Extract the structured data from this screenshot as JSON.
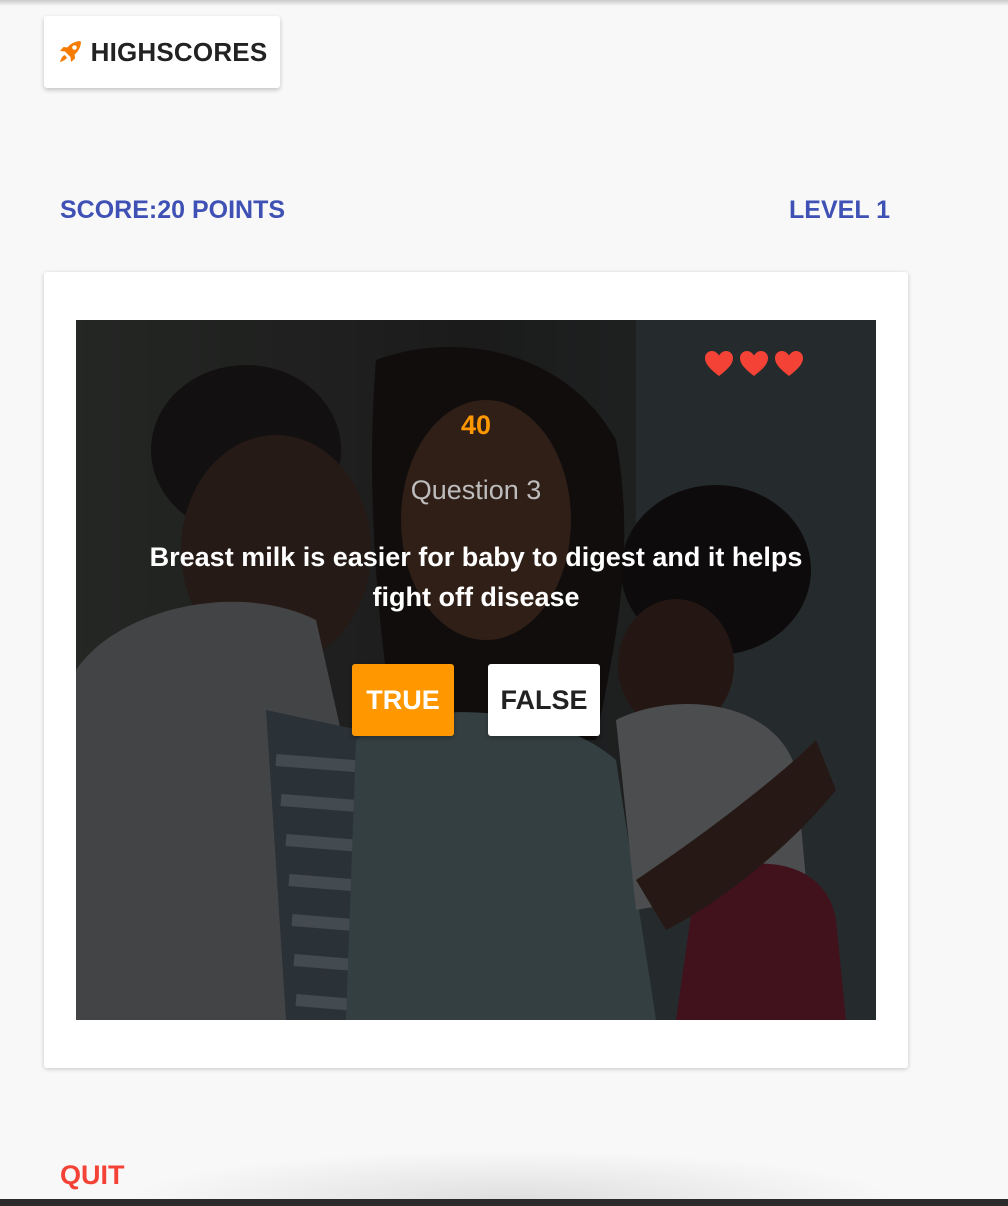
{
  "header": {
    "highscores_label": "HIGHSCORES",
    "highscores_icon": "rocket-icon",
    "icon_color": "#f57c00"
  },
  "status": {
    "score_text": "SCORE:20 POINTS",
    "level_text": "LEVEL 1",
    "accent_color": "#3f51b5"
  },
  "game": {
    "lives": 3,
    "life_icon": "heart-icon",
    "heart_color": "#f44336",
    "timer": "40",
    "question_number": "Question 3",
    "question_text": "Breast milk is easier for baby to digest and it helps fight off disease",
    "answers": {
      "true_label": "TRUE",
      "false_label": "FALSE"
    },
    "background_image": "family-photo"
  },
  "footer": {
    "quit_label": "QUIT",
    "quit_color": "#f44336"
  }
}
